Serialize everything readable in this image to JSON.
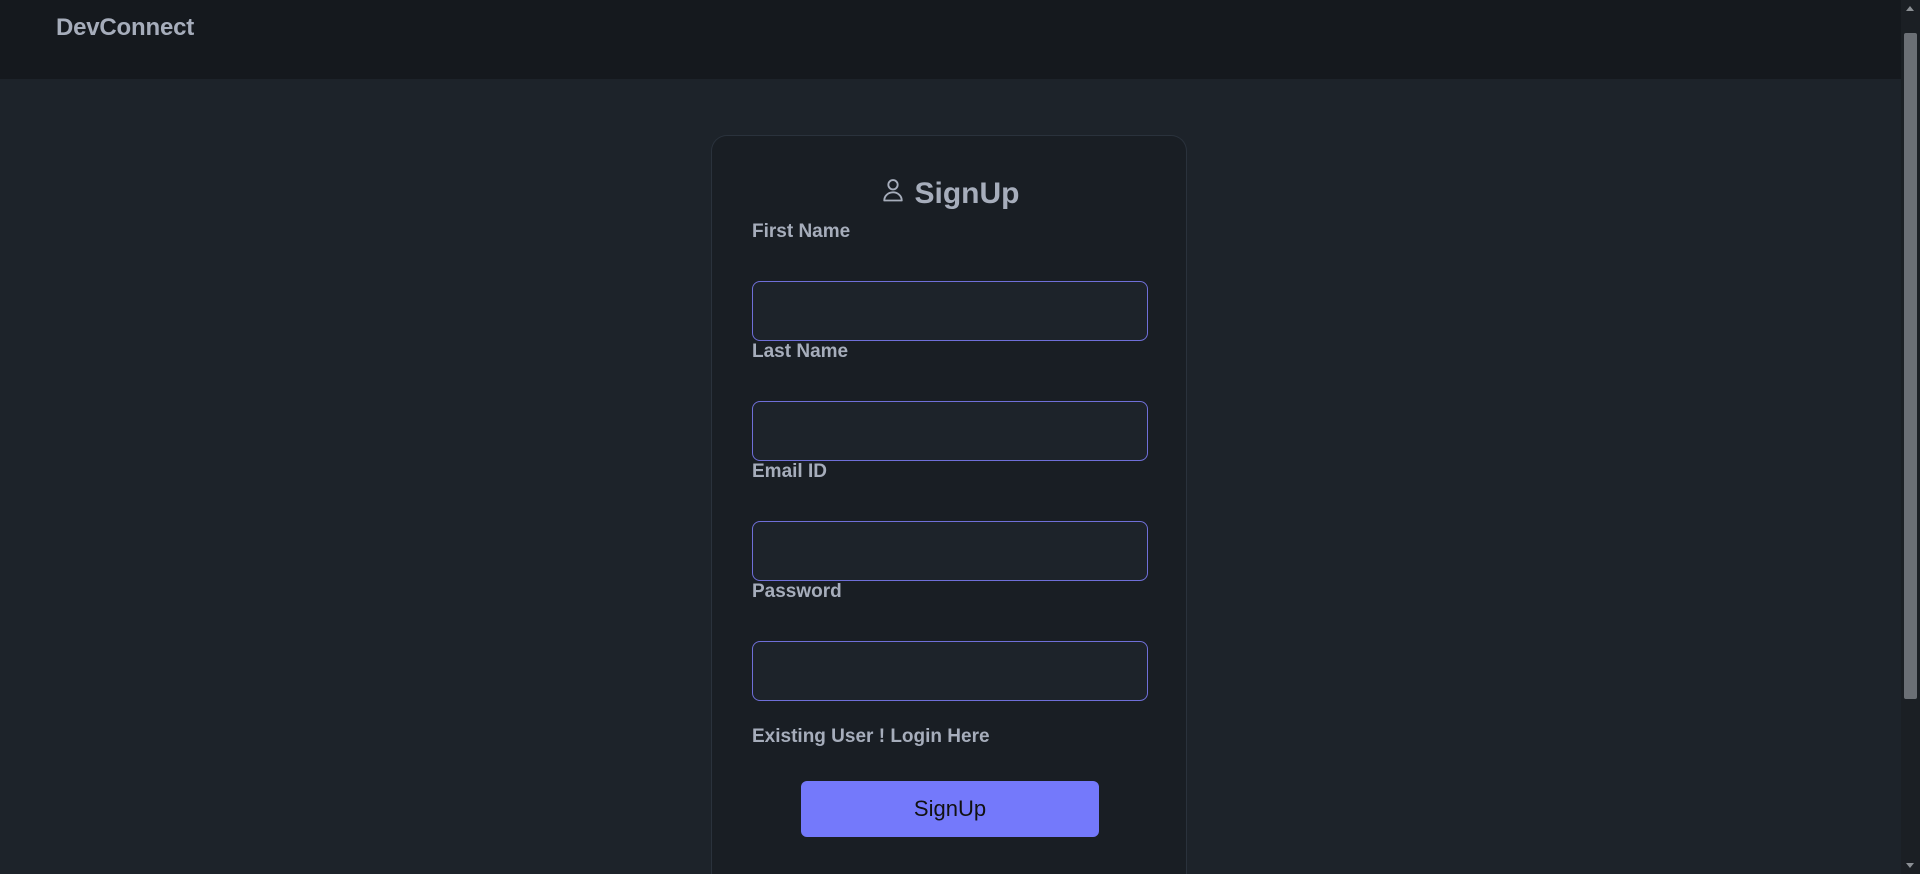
{
  "navbar": {
    "brand": "DevConnect"
  },
  "signup_card": {
    "title": "SignUp",
    "title_icon": "user-icon",
    "fields": [
      {
        "label": "First Name",
        "value": "",
        "type": "text"
      },
      {
        "label": "Last Name",
        "value": "",
        "type": "text"
      },
      {
        "label": "Email ID",
        "value": "",
        "type": "email"
      },
      {
        "label": "Password",
        "value": "",
        "type": "password"
      }
    ],
    "login_link": "Existing User ! Login Here",
    "submit_label": "SignUp"
  },
  "colors": {
    "background": "#1d232a",
    "navbar": "#15191e",
    "card": "#191e24",
    "input_border": "#6f6fd8",
    "primary": "#7479fb",
    "text": "#a6adbb"
  }
}
